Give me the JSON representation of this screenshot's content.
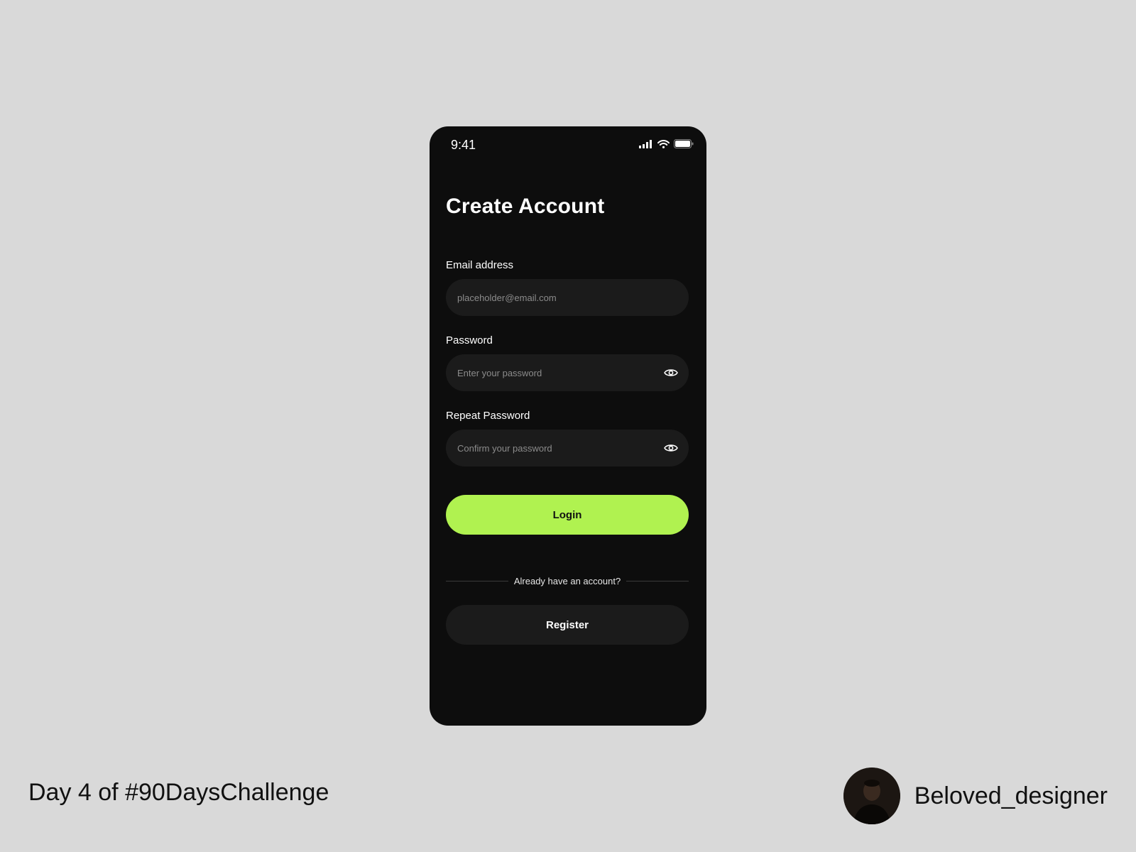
{
  "status_bar": {
    "time": "9:41"
  },
  "screen": {
    "title": "Create Account",
    "fields": [
      {
        "label": "Email address",
        "placeholder": "placeholder@email.com",
        "value": ""
      },
      {
        "label": "Password",
        "placeholder": "Enter your password",
        "value": "",
        "toggle_icon": "eye-icon"
      },
      {
        "label": "Repeat Password",
        "placeholder": "Confirm your password",
        "value": "",
        "toggle_icon": "eye-icon"
      }
    ],
    "primary_button": "Login",
    "divider_text": "Already have an account?",
    "secondary_button": "Register"
  },
  "footer": {
    "caption": "Day 4 of #90DaysChallenge",
    "author_name": "Beloved_designer"
  },
  "colors": {
    "page_background": "#d9d9d9",
    "phone_background": "#0d0d0d",
    "input_background": "#1b1b1b",
    "accent": "#b0f250"
  }
}
